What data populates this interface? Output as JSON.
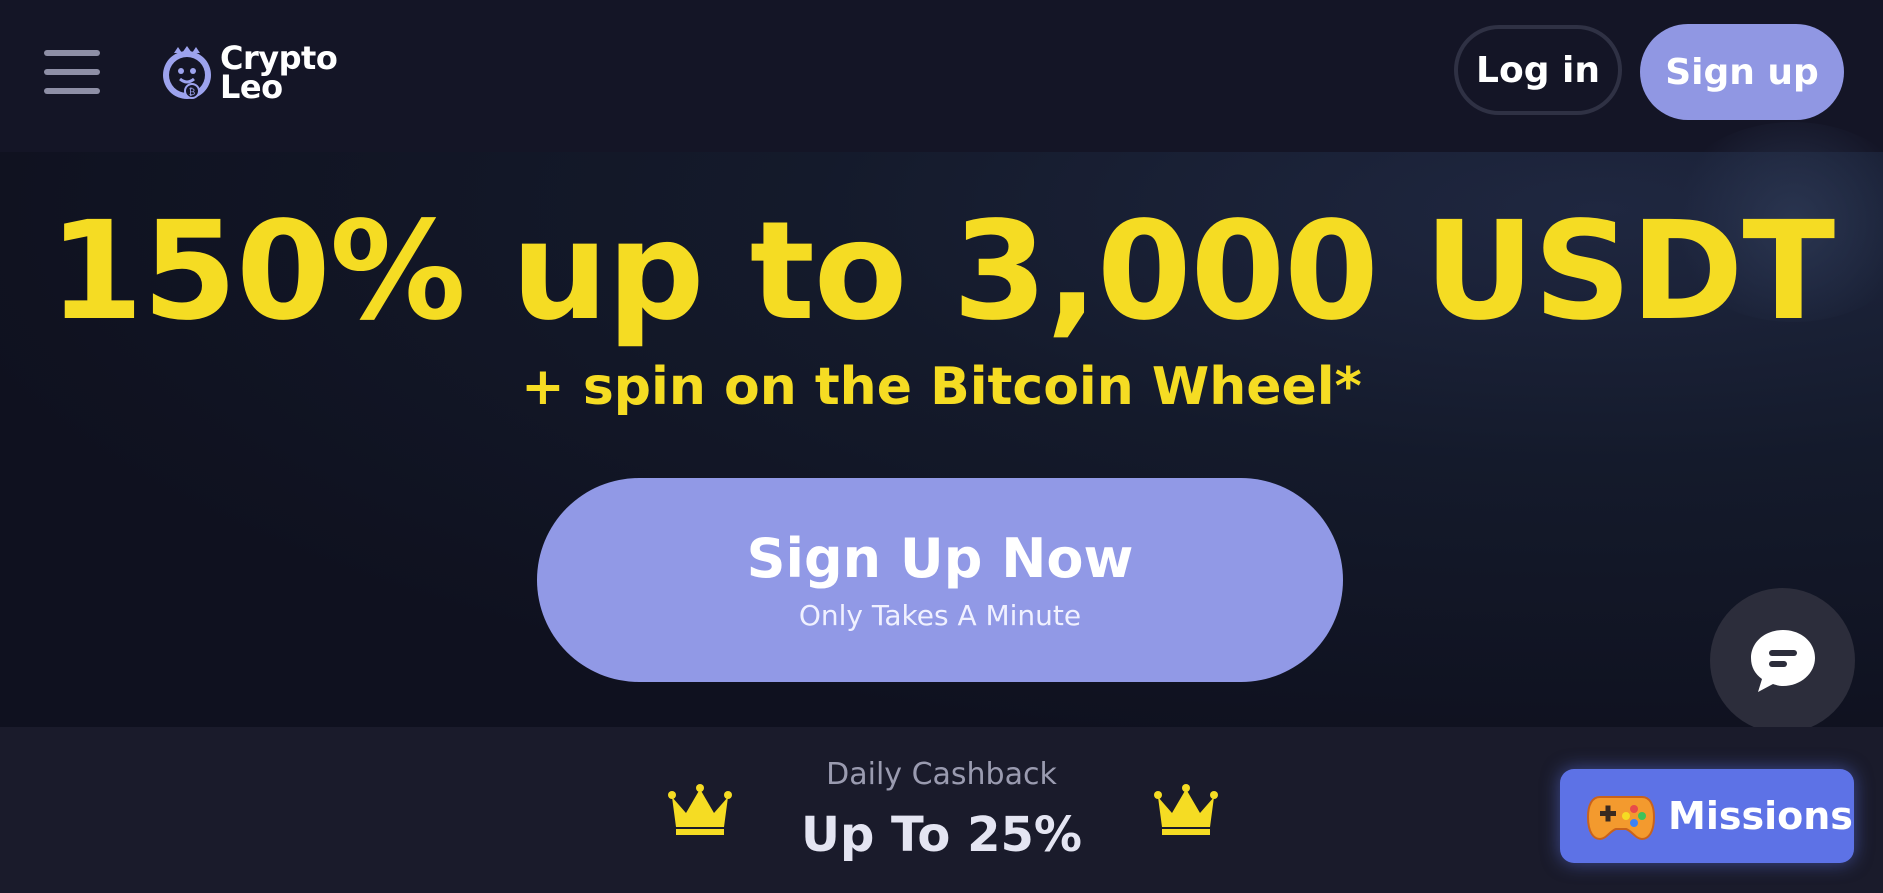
{
  "header": {
    "logo_line1": "Crypto",
    "logo_line2": "Leo",
    "menu_icon": "hamburger-menu-icon",
    "login_label": "Log in",
    "signup_label": "Sign up"
  },
  "hero": {
    "headline": "150% up to 3,000 USDT",
    "subheadline": "+ spin on the Bitcoin Wheel*",
    "cta_title": "Sign Up Now",
    "cta_subtitle": "Only Takes A Minute"
  },
  "cashback": {
    "label": "Daily Cashback",
    "value": "Up To 25%",
    "icon": "crown-icon"
  },
  "floating": {
    "chat_icon": "chat-bubble-icon",
    "missions_label": "Missions",
    "missions_icon": "gamepad-icon"
  },
  "colors": {
    "background": "#111321",
    "header_bg": "#141526",
    "accent_yellow": "#f5dc23",
    "accent_purple": "#9199e6",
    "missions_blue": "#5d72e6"
  }
}
